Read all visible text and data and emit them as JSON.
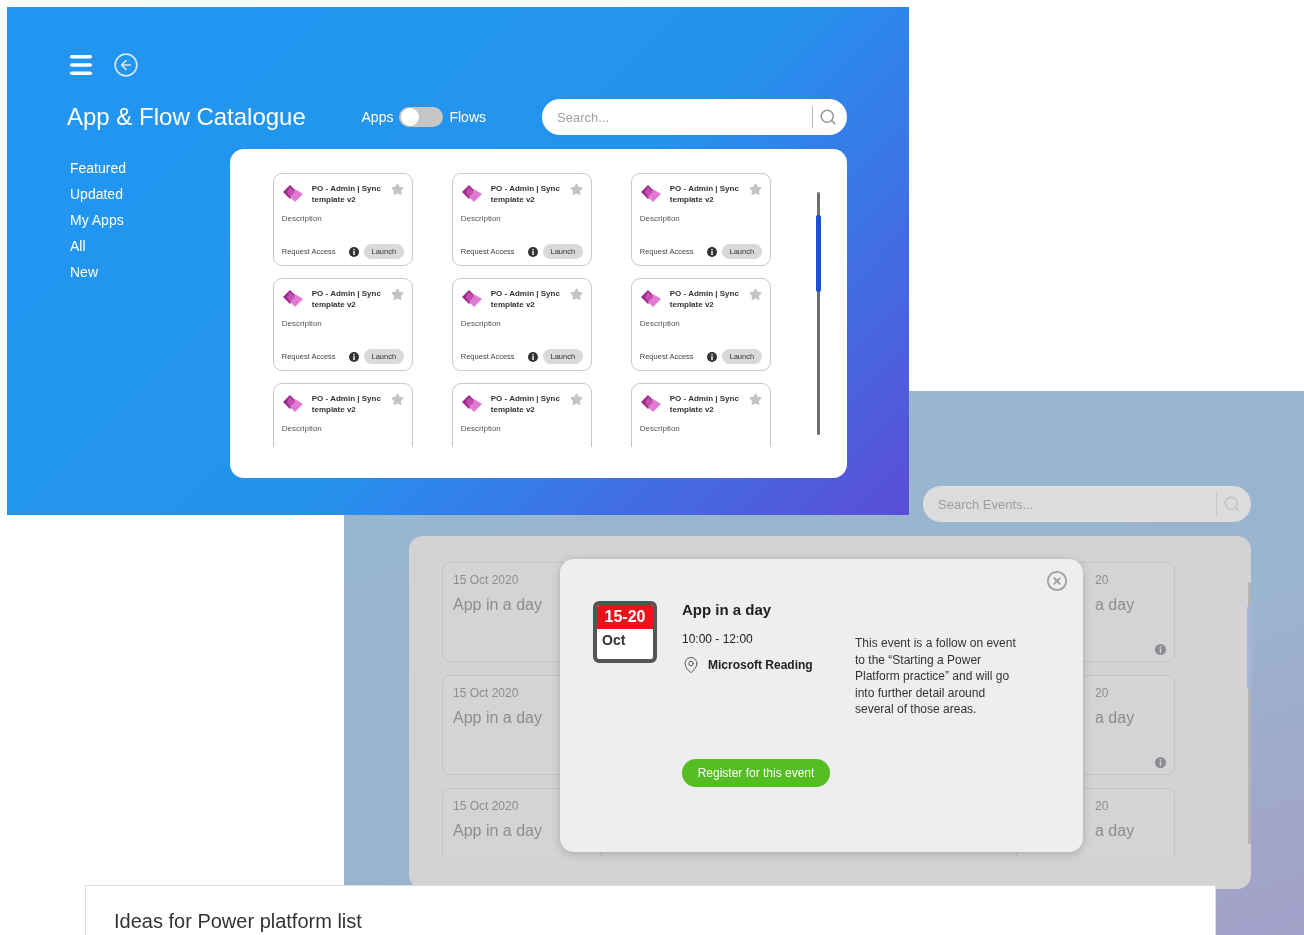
{
  "catalogue_window": {
    "title": "App & Flow Catalogue",
    "toggle": {
      "left_label": "Apps",
      "right_label": "Flows",
      "on": false
    },
    "search": {
      "placeholder": "Search..."
    },
    "nav": [
      {
        "label": "Featured"
      },
      {
        "label": "Updated"
      },
      {
        "label": "My Apps"
      },
      {
        "label": "All"
      },
      {
        "label": "New"
      }
    ],
    "cards": [
      {
        "title": "PO - Admin | Sync\ntemplate v2",
        "description": "Description",
        "starred": false,
        "request_access": "Request Access",
        "launch": "Launch"
      },
      {
        "title": "PO - Admin | Sync\ntemplate v2",
        "description": "Description",
        "starred": false,
        "request_access": "Request Access",
        "launch": "Launch"
      },
      {
        "title": "PO - Admin | Sync\ntemplate v2",
        "description": "Description",
        "starred": false,
        "request_access": "Request Access",
        "launch": "Launch"
      },
      {
        "title": "PO - Admin | Sync\ntemplate v2",
        "description": "Description",
        "starred": false,
        "request_access": "Request Access",
        "launch": "Launch"
      },
      {
        "title": "PO - Admin | Sync\ntemplate v2",
        "description": "Description",
        "starred": false,
        "request_access": "Request Access",
        "launch": "Launch"
      },
      {
        "title": "PO - Admin | Sync\ntemplate v2",
        "description": "Description",
        "starred": false,
        "request_access": "Request Access",
        "launch": "Launch"
      },
      {
        "title": "PO - Admin | Sync\ntemplate v2",
        "description": "Description",
        "starred": false
      },
      {
        "title": "PO - Admin | Sync\ntemplate v2",
        "description": "Description",
        "starred": false
      },
      {
        "title": "PO - Admin | Sync\ntemplate v2",
        "description": "Description",
        "starred": false
      }
    ]
  },
  "events_window": {
    "search": {
      "placeholder": "Search Events..."
    },
    "events_left": [
      {
        "date": "15 Oct 2020",
        "title": "App in a day"
      },
      {
        "date": "15 Oct 2020",
        "title": "App in a day"
      },
      {
        "date": "15 Oct 2020",
        "title": "App in a day"
      }
    ],
    "events_right": [
      {
        "date": "20",
        "title": "a day",
        "has_info": true
      },
      {
        "date": "20",
        "title": "a day",
        "has_info": true
      },
      {
        "date": "20",
        "title": "a day"
      }
    ],
    "popup": {
      "calendar": {
        "days": "15-20",
        "month": "Oct"
      },
      "title": "App in a day",
      "time": "10:00 - 12:00",
      "location": "Microsoft Reading",
      "description": "This event is a follow on event to the “Starting a Power Platform practice” and will go into further detail around several of those areas.",
      "button": "Register for this event"
    }
  },
  "list_window": {
    "title": "Ideas for Power platform list"
  }
}
